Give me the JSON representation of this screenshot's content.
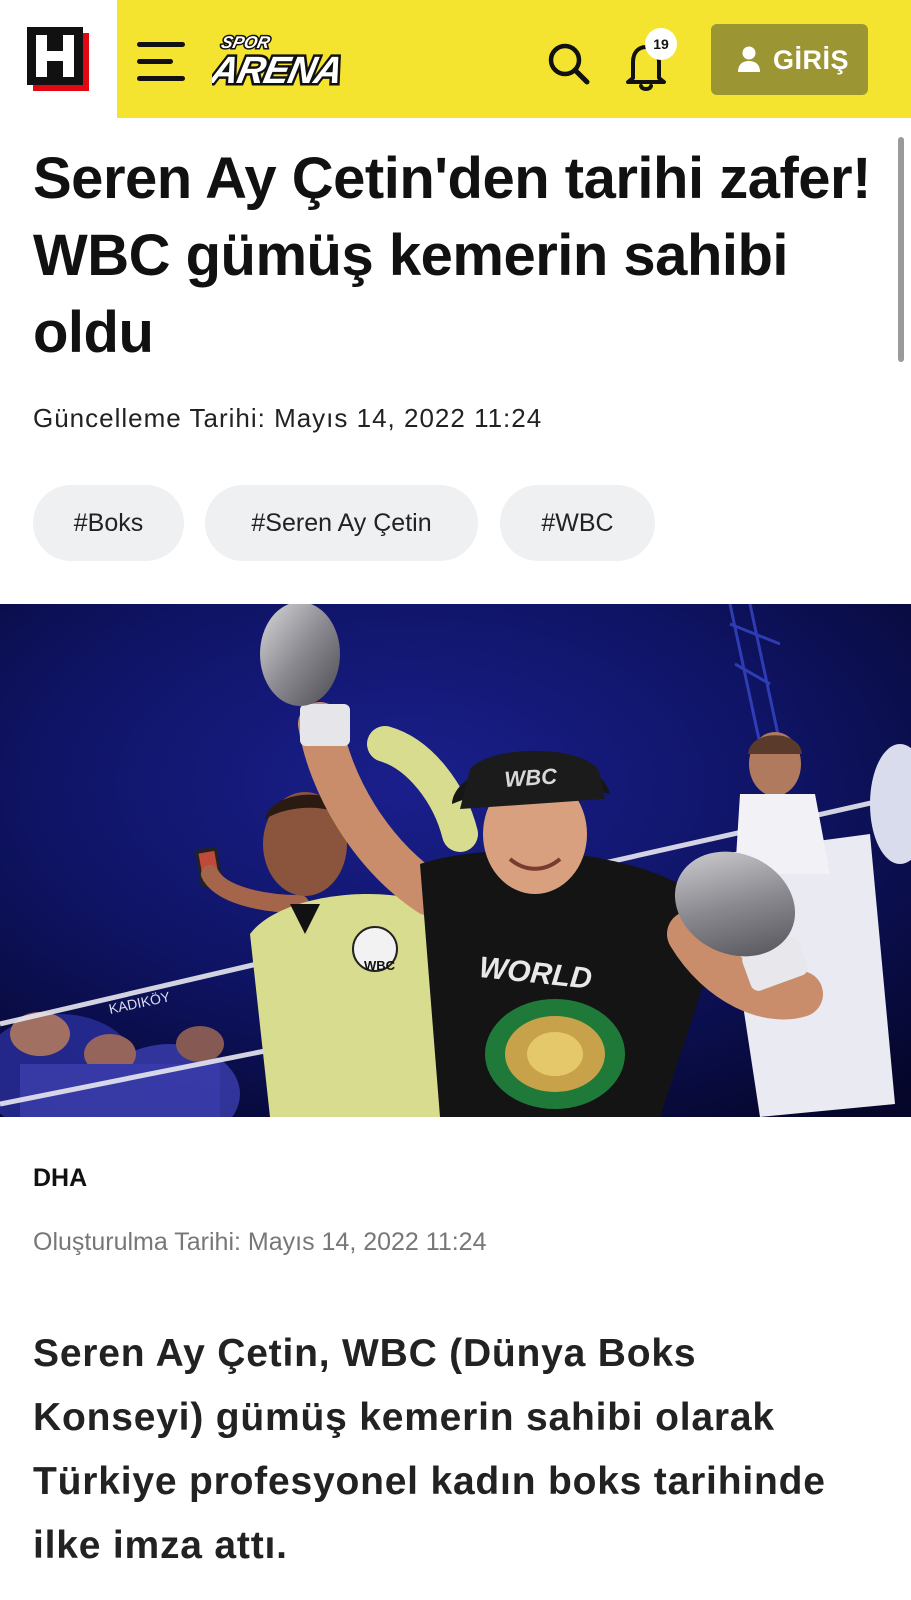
{
  "header": {
    "logo_letter": "H",
    "brand_small": "SPOR",
    "brand_large": "ARENA",
    "notification_count": "19",
    "login_label": "GİRİŞ",
    "colors": {
      "accent_yellow": "#f4e42f",
      "login_button": "#9c9534",
      "logo_red": "#e30613"
    },
    "icons": [
      "menu-icon",
      "search-icon",
      "bell-icon",
      "user-icon"
    ]
  },
  "article": {
    "headline": "Seren Ay Çetin'den tarihi zafer! WBC gümüş kemerin sahibi oldu",
    "updated": "Güncelleme Tarihi: Mayıs 14, 2022 11:24",
    "tags": [
      "#Boks",
      "#Seren Ay Çetin",
      "#WBC"
    ],
    "photo": {
      "shirt_text": "WORLD",
      "cap_text": "WBC",
      "badge_text": "WBC",
      "banner_text": "KADIKÖY"
    },
    "source": "DHA",
    "created": "Oluşturulma Tarihi: Mayıs 14, 2022 11:24",
    "lead": "Seren Ay Çetin, WBC (Dünya Boks Konseyi) gümüş kemerin sahibi olarak Türkiye profesyonel kadın boks tarihinde ilke imza attı."
  }
}
